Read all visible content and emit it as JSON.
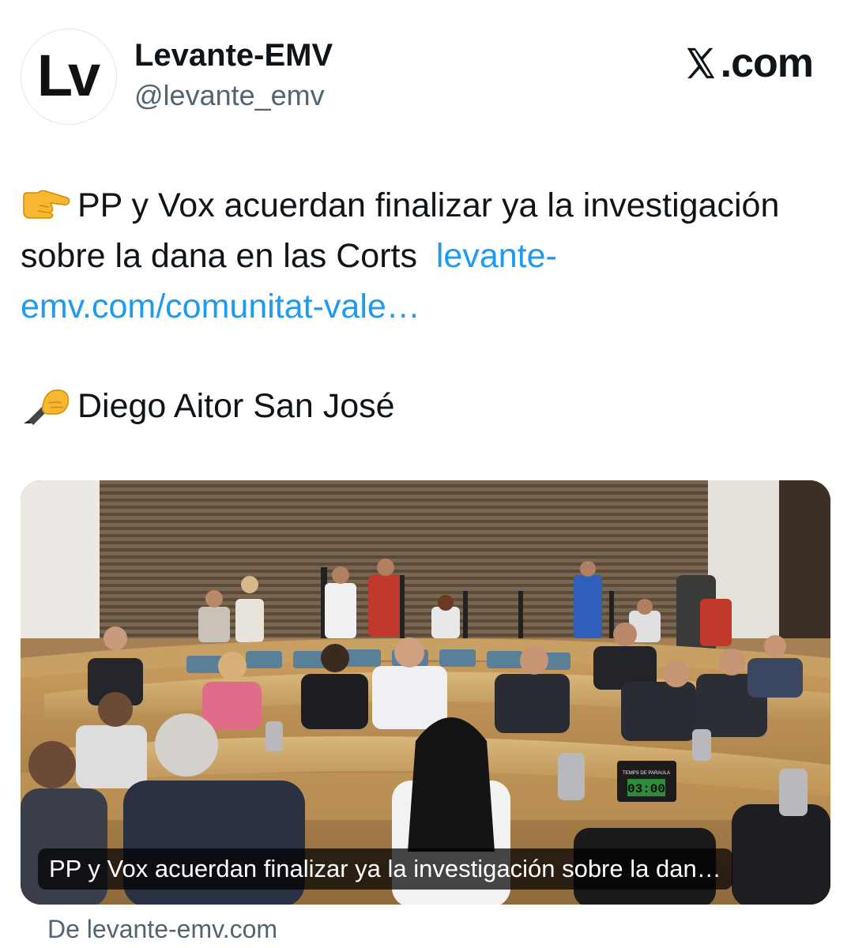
{
  "account": {
    "avatar_text": "Lv",
    "display_name": "Levante-EMV",
    "handle": "@levante_emv"
  },
  "platform": {
    "logo_icon": "x-logo-icon",
    "label": ".com"
  },
  "tweet": {
    "pointing_emoji": "backhand-index-pointing-right",
    "headline": "PP y Vox acuerdan finalizar ya la investigación sobre la dana en las Corts",
    "link_text": "levante-emv.com/comunitat-vale…",
    "writing_emoji": "writing-hand",
    "author": "Diego Aitor San José"
  },
  "card": {
    "caption": "PP y Vox acuerdan finalizar ya la investigación sobre la dan…",
    "timer_label": "TEMPS DE PARAULA",
    "timer_value": "03:00",
    "source": "De levante-emv.com"
  },
  "colors": {
    "link": "#1d9bf0",
    "secondary_text": "#536471",
    "primary_text": "#0f1419"
  }
}
